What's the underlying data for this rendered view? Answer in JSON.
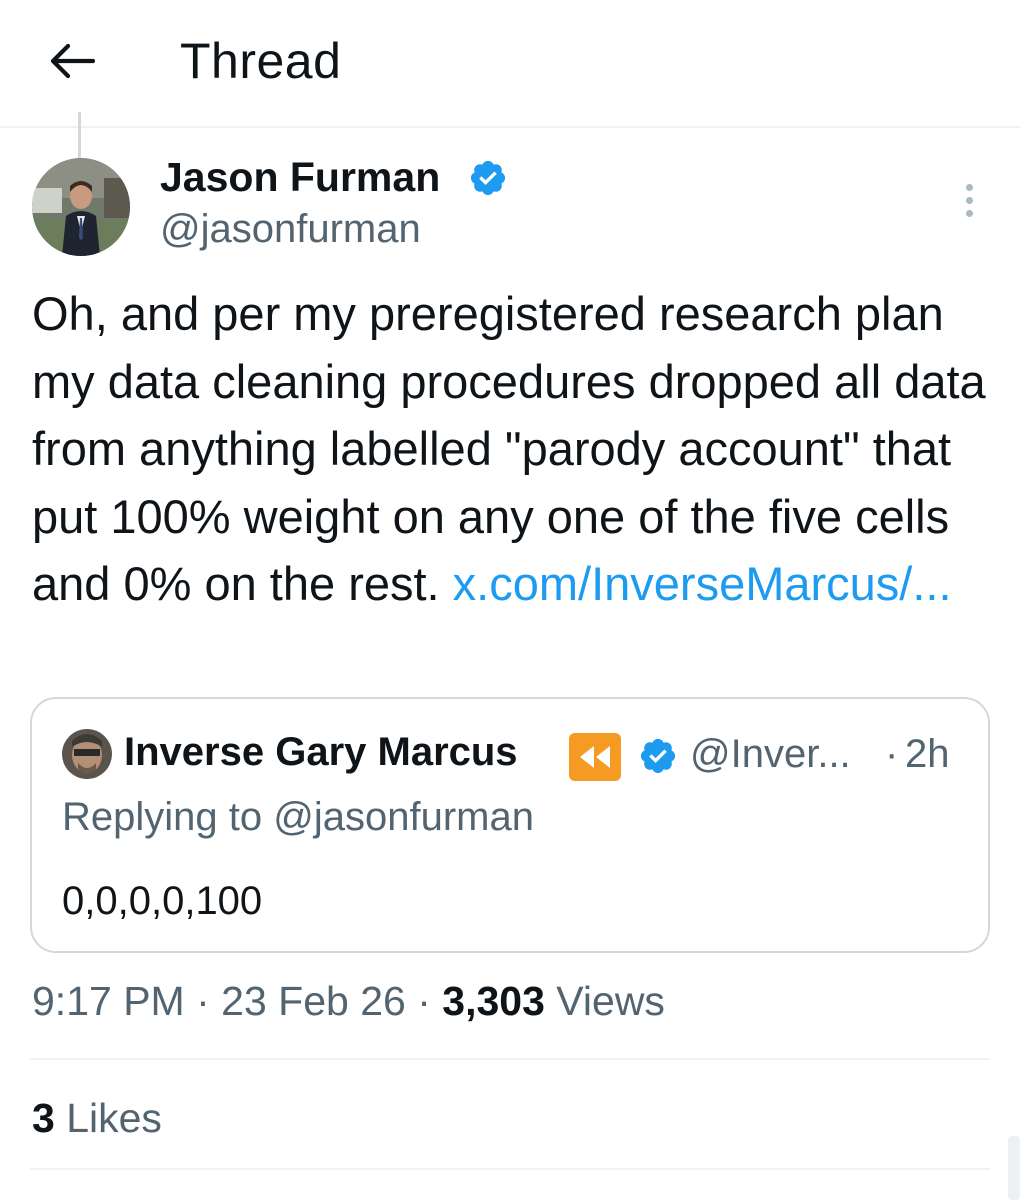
{
  "header": {
    "title": "Thread",
    "back_icon": "arrow-left-icon"
  },
  "tweet": {
    "author_name": "Jason Furman",
    "author_handle": "@jasonfurman",
    "verified_icon": "verified-badge-icon",
    "verified_color": "#1d9bf0",
    "text": "Oh, and per my preregistered research plan my data cleaning procedures dropped all data from anything labelled \"parody account\" that put 100% weight on any one of the five cells and 0% on the rest. ",
    "link_text": "x.com/InverseMarcus/...",
    "link_color": "#1d9bf0",
    "time": "9:17 PM",
    "separator": "·",
    "date": "23 Feb 26",
    "views_count": "3,303",
    "views_label": "Views",
    "likes_count": "3",
    "likes_label": "Likes"
  },
  "quote": {
    "author_name": "Inverse Gary Marcus",
    "emoji_icon": "rewind-emoji-icon",
    "verified_icon": "verified-badge-icon",
    "author_handle": "@Inver...",
    "separator": "·",
    "time": "2h",
    "reply_context": "Replying to @jasonfurman",
    "text": "0,0,0,0,100"
  }
}
